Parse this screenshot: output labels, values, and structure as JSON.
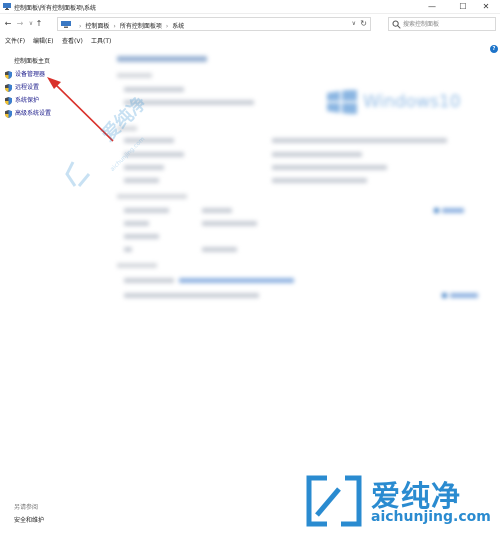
{
  "window": {
    "title": "控制面板\\所有控制面板项\\系统",
    "min": "—",
    "max": "☐",
    "close": "✕"
  },
  "nav": {
    "back": "←",
    "forward": "→",
    "recent": "∨",
    "up": "↑"
  },
  "address": {
    "crumbs": [
      "控制面板",
      "所有控制面板项",
      "系统"
    ],
    "separator": "›",
    "dropdown": "∨",
    "refresh": "↻"
  },
  "search": {
    "placeholder": "搜索控制面板"
  },
  "menubar": {
    "items": [
      "文件(F)",
      "编辑(E)",
      "查看(V)",
      "工具(T)"
    ]
  },
  "help": "?",
  "sidebar": {
    "home": "控制面板主页",
    "links": [
      "设备管理器",
      "远程设置",
      "系统保护",
      "高级系统设置"
    ],
    "see_also_heading": "另请参阅",
    "see_also_items": [
      "安全和维护"
    ]
  },
  "main": {
    "windows_logo_text": "Windows",
    "windows_version": "10"
  },
  "watermark": {
    "brand_cn": "爱纯净",
    "url": "aichunjing.com"
  },
  "colors": {
    "accent": "#1e74c9",
    "link": "#1a1a8a",
    "watermark": "#2a8bd0",
    "arrow": "#d9312b"
  }
}
